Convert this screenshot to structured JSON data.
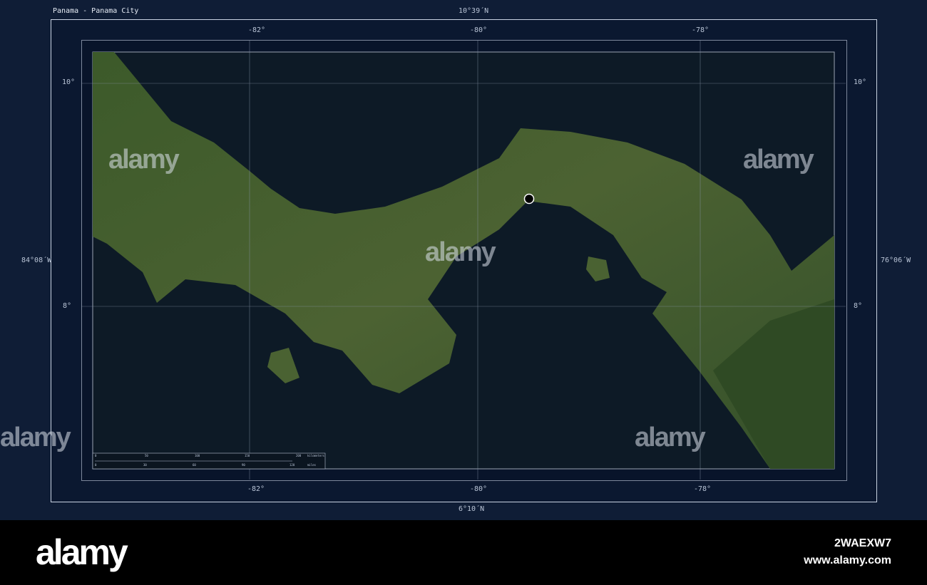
{
  "title": "Panama - Panama City",
  "frame_labels": {
    "top": "10°39´N",
    "bottom": "6°10´N",
    "left": "84°08´W",
    "right": "76°06´W"
  },
  "lon_ticks": [
    "-82°",
    "-80°",
    "-78°"
  ],
  "lat_ticks": [
    "10°",
    "8°"
  ],
  "scale_bar": {
    "km_ticks": [
      "0",
      "50",
      "100",
      "150",
      "200"
    ],
    "km_unit": "kilometers",
    "mi_ticks": [
      "0",
      "30",
      "60",
      "90",
      "120"
    ],
    "mi_unit": "miles"
  },
  "city_marker": "Panama City",
  "watermark": "alamy",
  "footer": {
    "logo": "alamy",
    "image_id": "2WAEXW7",
    "url": "www.alamy.com"
  },
  "colors": {
    "background": "#0f1d36",
    "sea": "#0d1a26",
    "land": "#3f5a2c",
    "frame": "#c9d3e3"
  }
}
